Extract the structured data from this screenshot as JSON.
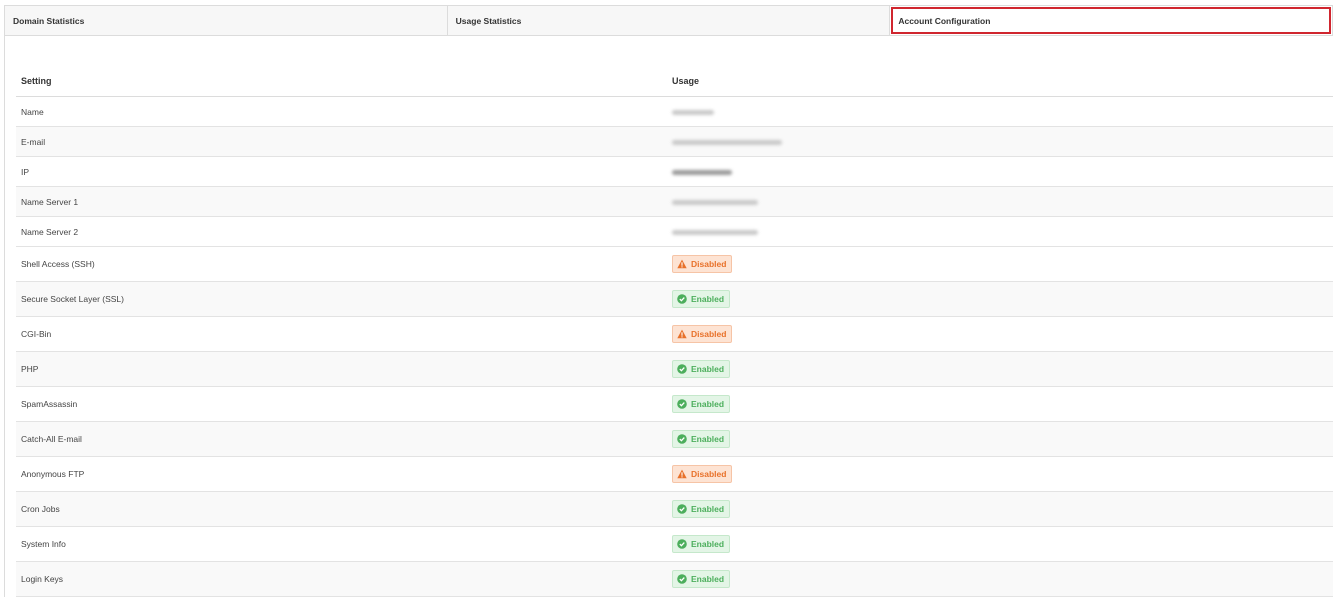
{
  "tabs": [
    {
      "label": "Domain Statistics",
      "active": false
    },
    {
      "label": "Usage Statistics",
      "active": false
    },
    {
      "label": "Account Configuration",
      "active": true
    }
  ],
  "table": {
    "headers": {
      "setting": "Setting",
      "usage": "Usage"
    },
    "info_rows": [
      {
        "setting": "Name"
      },
      {
        "setting": "E-mail"
      },
      {
        "setting": "IP"
      },
      {
        "setting": "Name Server 1"
      },
      {
        "setting": "Name Server 2"
      }
    ],
    "feature_rows": [
      {
        "setting": "Shell Access (SSH)",
        "status": "Disabled"
      },
      {
        "setting": "Secure Socket Layer (SSL)",
        "status": "Enabled"
      },
      {
        "setting": "CGI-Bin",
        "status": "Disabled"
      },
      {
        "setting": "PHP",
        "status": "Enabled"
      },
      {
        "setting": "SpamAssassin",
        "status": "Enabled"
      },
      {
        "setting": "Catch-All E-mail",
        "status": "Enabled"
      },
      {
        "setting": "Anonymous FTP",
        "status": "Disabled"
      },
      {
        "setting": "Cron Jobs",
        "status": "Enabled"
      },
      {
        "setting": "System Info",
        "status": "Enabled"
      },
      {
        "setting": "Login Keys",
        "status": "Enabled"
      }
    ]
  },
  "colors": {
    "active_tab_border": "#d0262f",
    "disabled": "#e8712a",
    "enabled": "#4cae5c"
  },
  "icons": {
    "disabled": "warning-triangle-icon",
    "enabled": "check-circle-icon"
  }
}
